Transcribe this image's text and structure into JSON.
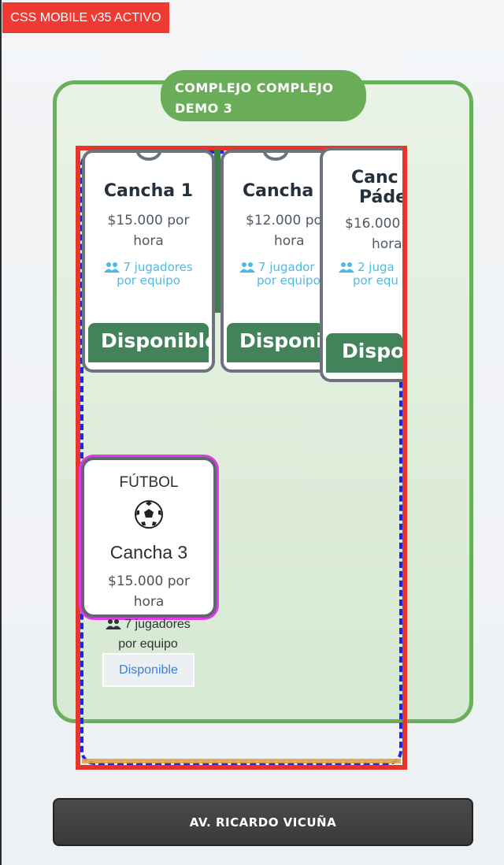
{
  "debug_badge": "CSS MOBILE v35 ACTIVO",
  "complex": {
    "title": "COMPLEJO COMPLEJO DEMO 3",
    "accent_color": "#69ad59"
  },
  "courts": [
    {
      "name": "Cancha 1",
      "price_line1": "$15.000 por",
      "price_line2": "hora",
      "players_line1": "7 jugadores",
      "players_line2": "por equipo",
      "status": "Disponible"
    },
    {
      "name": "Cancha",
      "price_line1": "$12.000 po",
      "price_line2": "hora",
      "players_line1": "7 jugador",
      "players_line2": "por equipo",
      "status": "Disponi"
    },
    {
      "name_line1": "Canc",
      "name_line2": "Páde",
      "price_line1": "$16.000",
      "price_line2": "hora",
      "players_line1": "2 juga",
      "players_line2": "por equ",
      "status": "Dispo"
    }
  ],
  "futbol_card": {
    "sport": "FÚTBOL",
    "icon": "soccer-ball-icon",
    "name": "Cancha 3",
    "price_line1": "$15.000 por",
    "price_line2": "hora",
    "players_line1": "7 jugadores",
    "players_line2": "por equipo",
    "status": "Disponible"
  },
  "bottom_bar": {
    "label": "AV. RICARDO VICUÑA"
  },
  "colors": {
    "status_green": "#43835a",
    "debug_red": "#ee3a32",
    "players_blue": "#4fb9e6"
  }
}
